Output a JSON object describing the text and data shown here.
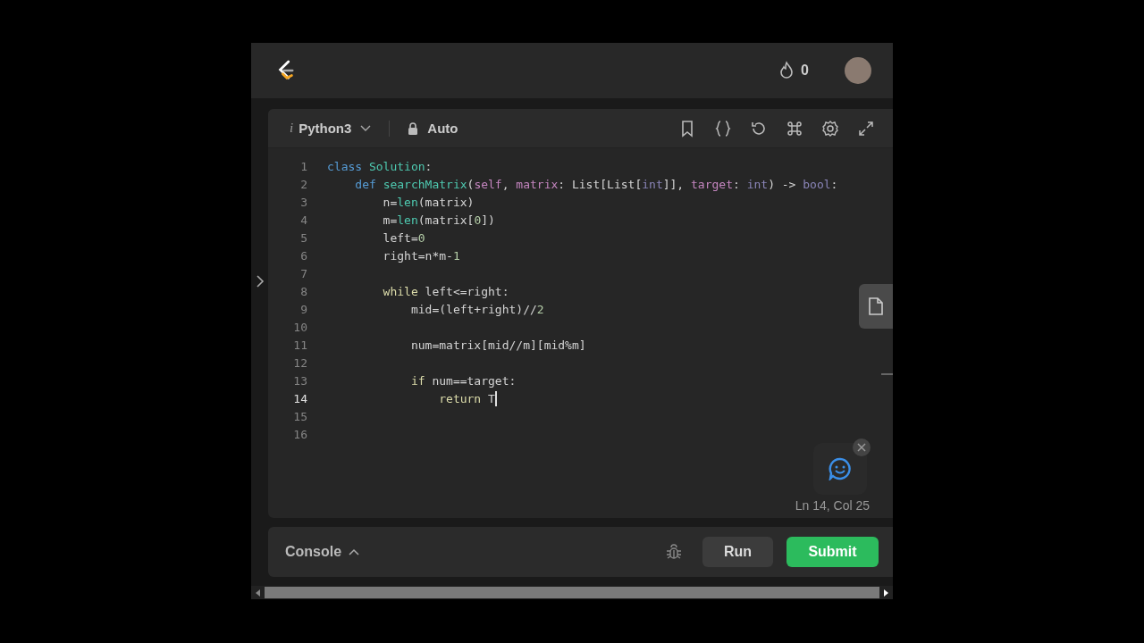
{
  "header": {
    "streak_count": "0"
  },
  "editor_toolbar": {
    "language_mark": "i",
    "language": "Python3",
    "mode": "Auto"
  },
  "code_lines": [
    {
      "number": "1",
      "active": false,
      "tokens": [
        {
          "text": "class ",
          "kind": "keyword"
        },
        {
          "text": "Solution",
          "kind": "classname"
        },
        {
          "text": ":",
          "kind": "plain"
        }
      ]
    },
    {
      "number": "2",
      "active": false,
      "tokens": [
        {
          "text": "    def ",
          "kind": "keyword"
        },
        {
          "text": "searchMatrix",
          "kind": "function"
        },
        {
          "text": "(",
          "kind": "plain"
        },
        {
          "text": "self",
          "kind": "param"
        },
        {
          "text": ", ",
          "kind": "plain"
        },
        {
          "text": "matrix",
          "kind": "param"
        },
        {
          "text": ": List[List[",
          "kind": "plain"
        },
        {
          "text": "int",
          "kind": "type"
        },
        {
          "text": "]], ",
          "kind": "plain"
        },
        {
          "text": "target",
          "kind": "param"
        },
        {
          "text": ": ",
          "kind": "plain"
        },
        {
          "text": "int",
          "kind": "type"
        },
        {
          "text": ") -> ",
          "kind": "plain"
        },
        {
          "text": "bool",
          "kind": "type"
        },
        {
          "text": ":",
          "kind": "plain"
        }
      ]
    },
    {
      "number": "3",
      "active": false,
      "tokens": [
        {
          "text": "        n=",
          "kind": "plain"
        },
        {
          "text": "len",
          "kind": "builtin"
        },
        {
          "text": "(matrix)",
          "kind": "plain"
        }
      ]
    },
    {
      "number": "4",
      "active": false,
      "tokens": [
        {
          "text": "        m=",
          "kind": "plain"
        },
        {
          "text": "len",
          "kind": "builtin"
        },
        {
          "text": "(matrix[",
          "kind": "plain"
        },
        {
          "text": "0",
          "kind": "number"
        },
        {
          "text": "])",
          "kind": "plain"
        }
      ]
    },
    {
      "number": "5",
      "active": false,
      "tokens": [
        {
          "text": "        left=",
          "kind": "plain"
        },
        {
          "text": "0",
          "kind": "number"
        }
      ]
    },
    {
      "number": "6",
      "active": false,
      "tokens": [
        {
          "text": "        right=n*m-",
          "kind": "plain"
        },
        {
          "text": "1",
          "kind": "number"
        }
      ]
    },
    {
      "number": "7",
      "active": false
    },
    {
      "number": "8",
      "active": false,
      "tokens": [
        {
          "text": "        while ",
          "kind": "control"
        },
        {
          "text": "left<=right:",
          "kind": "plain"
        }
      ]
    },
    {
      "number": "9",
      "active": false,
      "tokens": [
        {
          "text": "            mid=(left+right)//",
          "kind": "plain"
        },
        {
          "text": "2",
          "kind": "number"
        }
      ]
    },
    {
      "number": "10",
      "active": false
    },
    {
      "number": "11",
      "active": false,
      "tokens": [
        {
          "text": "            num=matrix[mid//m][mid%m]",
          "kind": "plain"
        }
      ]
    },
    {
      "number": "12",
      "active": false
    },
    {
      "number": "13",
      "active": false,
      "tokens": [
        {
          "text": "            if ",
          "kind": "control"
        },
        {
          "text": "num==target:",
          "kind": "plain"
        }
      ]
    },
    {
      "number": "14",
      "active": true,
      "tokens": [
        {
          "text": "                return ",
          "kind": "control"
        },
        {
          "text": "T",
          "kind": "plain"
        }
      ]
    },
    {
      "number": "15",
      "active": false
    },
    {
      "number": "16",
      "active": false
    }
  ],
  "cursor_position": "Ln 14, Col 25",
  "console_bar": {
    "console_label": "Console",
    "run_label": "Run",
    "submit_label": "Submit"
  }
}
